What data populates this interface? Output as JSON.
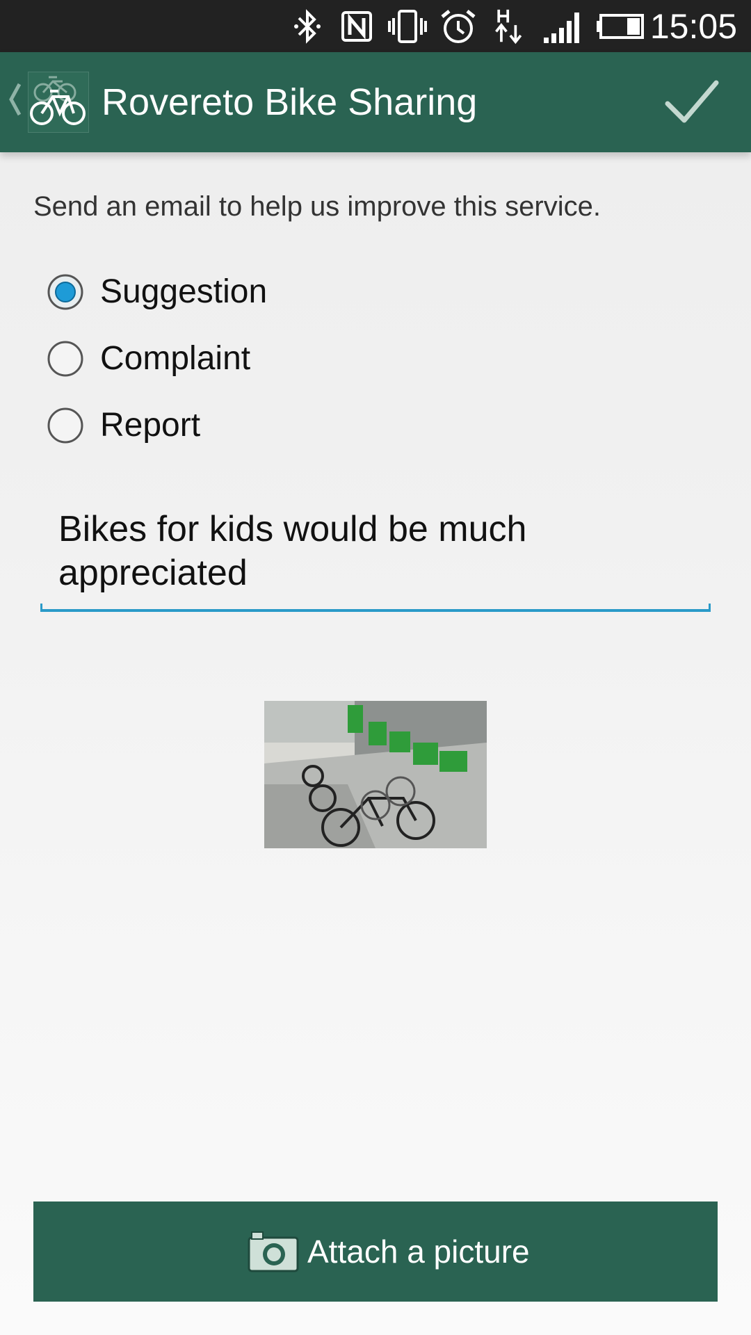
{
  "status_bar": {
    "time": "15:05",
    "icons": [
      "bluetooth-icon",
      "nfc-icon",
      "vibrate-icon",
      "alarm-icon",
      "hspa-data-icon",
      "signal-icon",
      "battery-icon"
    ]
  },
  "action_bar": {
    "title": "Rovereto Bike Sharing",
    "logo_icon": "bike-logo-icon",
    "confirm_icon": "checkmark-icon"
  },
  "form": {
    "intro": "Send an email to help us improve this service.",
    "options": [
      {
        "label": "Suggestion",
        "selected": true
      },
      {
        "label": "Complaint",
        "selected": false
      },
      {
        "label": "Report",
        "selected": false
      }
    ],
    "message": "Bikes for kids would be much appreciated",
    "attach_button_label": "Attach a picture",
    "attach_icon": "camera-icon"
  },
  "colors": {
    "action_bar": "#2a6352",
    "accent": "#2a9ac8",
    "status_bar": "#222222"
  }
}
